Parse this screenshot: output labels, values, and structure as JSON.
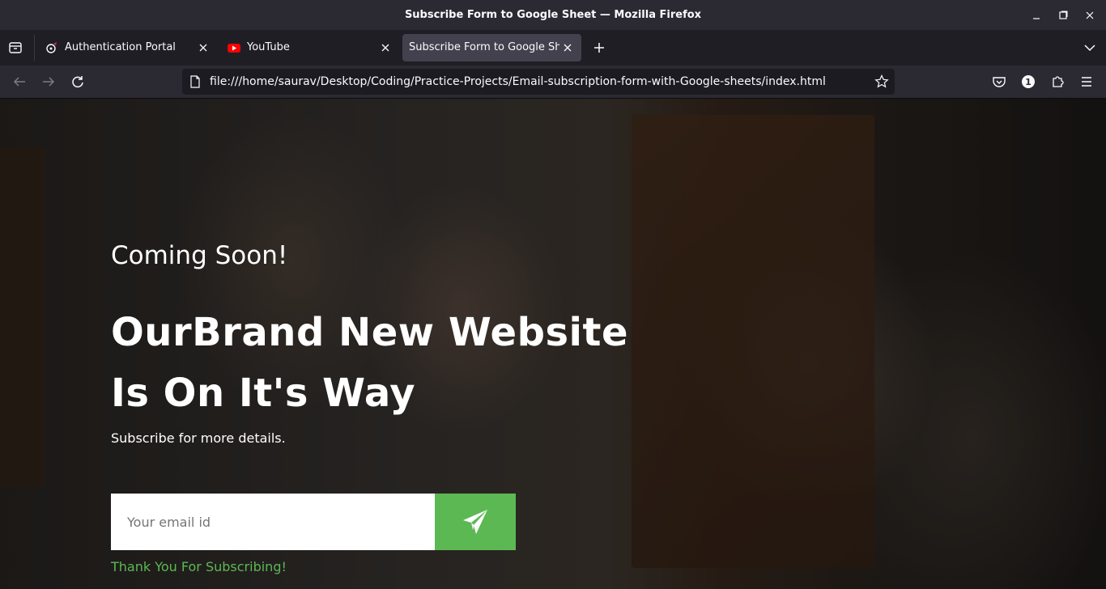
{
  "window": {
    "title": "Subscribe Form to Google Sheet — Mozilla Firefox"
  },
  "tabs": [
    {
      "label": "Authentication Portal",
      "icon": "portal-favicon-icon"
    },
    {
      "label": "YouTube",
      "icon": "youtube-favicon-icon"
    },
    {
      "label": "Subscribe Form to Google Sheet",
      "icon": "none",
      "active": true
    }
  ],
  "navbar": {
    "url": "file:///home/saurav/Desktop/Coding/Practice-Projects/Email-subscription-form-with-Google-sheets/index.html",
    "extension_badge": "1"
  },
  "page": {
    "kicker": "Coming Soon!",
    "headline": "OurBrand New Website Is On It's Way",
    "subtext": "Subscribe for more details.",
    "email_placeholder": "Your email id",
    "success_message": "Thank You For Subscribing!"
  },
  "colors": {
    "accent_green": "#5cb852",
    "chrome_dark": "#2b2a33",
    "tab_active": "#42414d"
  }
}
